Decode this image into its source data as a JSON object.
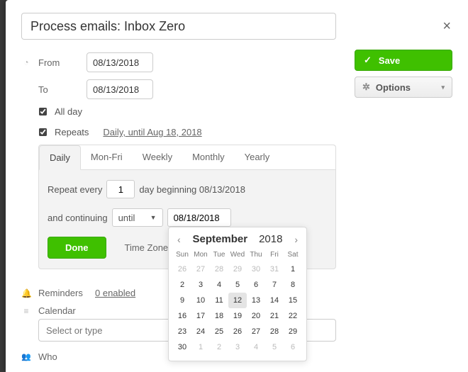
{
  "title": "Process emails: Inbox Zero",
  "actions": {
    "save": "Save",
    "options": "Options"
  },
  "dates": {
    "from_label": "From",
    "to_label": "To",
    "from_value": "08/13/2018",
    "to_value": "08/13/2018"
  },
  "allday": {
    "label": "All day",
    "checked": true
  },
  "repeats": {
    "label": "Repeats",
    "checked": true,
    "summary": "Daily, until Aug 18, 2018"
  },
  "repeat": {
    "tabs": [
      "Daily",
      "Mon-Fri",
      "Weekly",
      "Monthly",
      "Yearly"
    ],
    "active_tab": 0,
    "line1_a": "Repeat every",
    "every_value": "1",
    "line1_b": "day beginning 08/13/2018",
    "line2_a": "and continuing",
    "until_option": "until",
    "until_date": "08/18/2018",
    "done": "Done",
    "timezone_label": "Time Zone"
  },
  "reminders": {
    "label": "Reminders",
    "count_text": "0 enabled"
  },
  "calendar_row": {
    "label": "Calendar",
    "placeholder": "Select or type"
  },
  "who": {
    "label": "Who"
  },
  "calendar": {
    "month": "September",
    "year": "2018",
    "dow": [
      "Sun",
      "Mon",
      "Tue",
      "Wed",
      "Thu",
      "Fri",
      "Sat"
    ],
    "cells": [
      {
        "d": "26",
        "o": true
      },
      {
        "d": "27",
        "o": true
      },
      {
        "d": "28",
        "o": true
      },
      {
        "d": "29",
        "o": true
      },
      {
        "d": "30",
        "o": true
      },
      {
        "d": "31",
        "o": true
      },
      {
        "d": "1"
      },
      {
        "d": "2"
      },
      {
        "d": "3"
      },
      {
        "d": "4"
      },
      {
        "d": "5"
      },
      {
        "d": "6"
      },
      {
        "d": "7"
      },
      {
        "d": "8"
      },
      {
        "d": "9"
      },
      {
        "d": "10"
      },
      {
        "d": "11"
      },
      {
        "d": "12",
        "h": true
      },
      {
        "d": "13"
      },
      {
        "d": "14"
      },
      {
        "d": "15"
      },
      {
        "d": "16"
      },
      {
        "d": "17"
      },
      {
        "d": "18"
      },
      {
        "d": "19"
      },
      {
        "d": "20"
      },
      {
        "d": "21"
      },
      {
        "d": "22"
      },
      {
        "d": "23"
      },
      {
        "d": "24"
      },
      {
        "d": "25"
      },
      {
        "d": "26"
      },
      {
        "d": "27"
      },
      {
        "d": "28"
      },
      {
        "d": "29"
      },
      {
        "d": "30"
      },
      {
        "d": "1",
        "o": true
      },
      {
        "d": "2",
        "o": true
      },
      {
        "d": "3",
        "o": true
      },
      {
        "d": "4",
        "o": true
      },
      {
        "d": "5",
        "o": true
      },
      {
        "d": "6",
        "o": true
      }
    ]
  }
}
